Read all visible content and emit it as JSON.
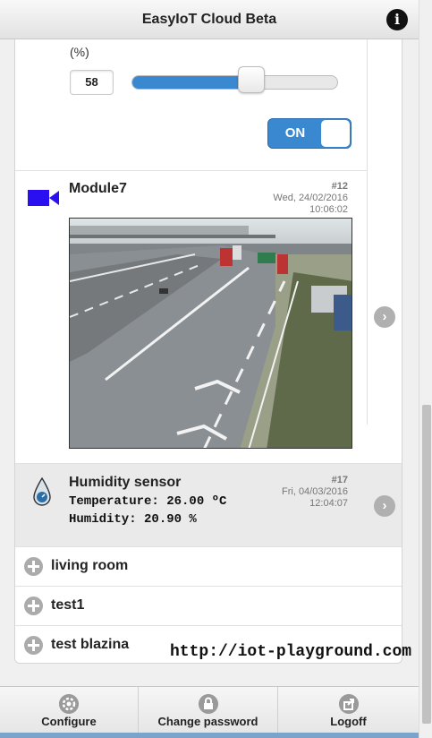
{
  "header": {
    "title": "EasyIoT Cloud Beta",
    "info_icon": "info-icon"
  },
  "slider_item": {
    "unit_label": "(%)",
    "value": "58",
    "slider_fraction": 0.58,
    "toggle_label": "ON"
  },
  "module7": {
    "name": "Module7",
    "id": "#12",
    "date": "Wed, 24/02/2016",
    "time": "10:06:02",
    "icon": "video-camera-icon",
    "icon_color": "#2a0ff0"
  },
  "humidity": {
    "name": "Humidity sensor",
    "id": "#17",
    "date": "Fri, 04/03/2016",
    "time": "12:04:07",
    "temperature_line": "Temperature: 26.00 ºC",
    "humidity_line": "Humidity: 20.90 %",
    "icon": "water-drop-icon"
  },
  "groups": [
    {
      "label": "living room"
    },
    {
      "label": "test1"
    },
    {
      "label": "test blazina"
    }
  ],
  "watermark": "http://iot-playground.com",
  "footer": [
    {
      "label": "Configure",
      "icon": "gear-icon"
    },
    {
      "label": "Change password",
      "icon": "lock-icon"
    },
    {
      "label": "Logoff",
      "icon": "logoff-icon"
    }
  ],
  "colors": {
    "accent": "#3a88d0",
    "camera_icon": "#2a0ff0"
  }
}
